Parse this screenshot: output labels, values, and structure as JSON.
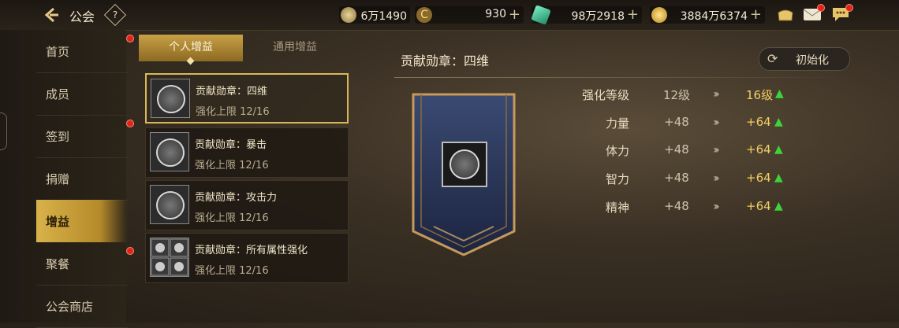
{
  "header": {
    "title": "公会",
    "help_label": "?",
    "resources": [
      {
        "name": "power",
        "icon": "sun-badge-icon",
        "value": "6万1490",
        "has_plus": false
      },
      {
        "name": "currency-c",
        "icon": "c-coin-icon",
        "value": "930",
        "has_plus": true
      },
      {
        "name": "crystal",
        "icon": "green-crystal-icon",
        "value": "98万2918",
        "has_plus": true
      },
      {
        "name": "gold",
        "icon": "gold-coin-icon",
        "value": "3884万6374",
        "has_plus": true
      }
    ],
    "plus_label": "+"
  },
  "sidebar": {
    "items": [
      {
        "label": "首页",
        "badge": true
      },
      {
        "label": "成员",
        "badge": false
      },
      {
        "label": "签到",
        "badge": true
      },
      {
        "label": "捐赠",
        "badge": false
      },
      {
        "label": "增益",
        "badge": false,
        "active": true
      },
      {
        "label": "聚餐",
        "badge": true
      },
      {
        "label": "公会商店",
        "badge": false
      }
    ]
  },
  "tabs": {
    "personal": "个人增益",
    "general": "通用增益"
  },
  "buffs": [
    {
      "name": "贡献勋章：四维",
      "limit": "强化上限 12/16",
      "icon": "four-stats-medal-icon",
      "selected": true
    },
    {
      "name": "贡献勋章：暴击",
      "limit": "强化上限 12/16",
      "icon": "crit-medal-icon",
      "selected": false
    },
    {
      "name": "贡献勋章：攻击力",
      "limit": "强化上限 12/16",
      "icon": "attack-medal-icon",
      "selected": false
    },
    {
      "name": "贡献勋章：所有属性强化",
      "limit": "强化上限 12/16",
      "icon": "all-attributes-icon",
      "selected": false
    }
  ],
  "detail": {
    "title": "贡献勋章：四维",
    "reset_label": "初始化",
    "stats": [
      {
        "name": "强化等级",
        "current": "12级",
        "next": "16级"
      },
      {
        "name": "力量",
        "current": "+48",
        "next": "+64"
      },
      {
        "name": "体力",
        "current": "+48",
        "next": "+64"
      },
      {
        "name": "智力",
        "current": "+48",
        "next": "+64"
      },
      {
        "name": "精神",
        "current": "+48",
        "next": "+64"
      }
    ],
    "arrow_glyph": "›››",
    "up_glyph": "▲"
  },
  "colors": {
    "accent_gold": "#d9b24a",
    "up_green": "#3fd23a",
    "badge_red": "#e0241a",
    "next_value": "#f2d064"
  }
}
